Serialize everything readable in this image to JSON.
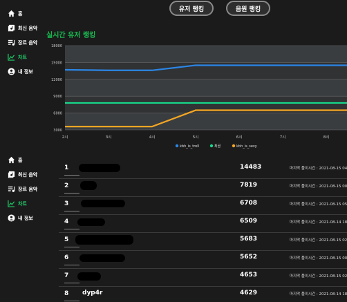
{
  "nav_top": [
    {
      "label": "홈",
      "icon": "home-icon"
    },
    {
      "label": "최신 음악",
      "icon": "new-music-icon"
    },
    {
      "label": "장르 음악",
      "icon": "genre-icon"
    },
    {
      "label": "차트",
      "icon": "chart-icon",
      "active": true
    },
    {
      "label": "내 정보",
      "icon": "account-icon"
    }
  ],
  "nav_bottom": [
    {
      "label": "홈",
      "icon": "home-icon"
    },
    {
      "label": "최신 음악",
      "icon": "new-music-icon"
    },
    {
      "label": "장르 음악",
      "icon": "genre-icon"
    },
    {
      "label": "차트",
      "icon": "chart-icon",
      "active": true
    },
    {
      "label": "내 정보",
      "icon": "account-icon"
    }
  ],
  "tabs": {
    "user_ranking": "유저 랭킹",
    "music_ranking": "음원 랭킹"
  },
  "section_title": "실시간 유저 랭킹",
  "colors": {
    "accent": "#19b84f",
    "series1": "#2b86e6",
    "series2": "#16d98b",
    "series3": "#f5a623"
  },
  "chart_data": {
    "type": "line",
    "title": "",
    "x": [
      "2시",
      "3시",
      "4시",
      "5시",
      "6시",
      "7시",
      "8시"
    ],
    "yticks": [
      3000,
      6000,
      9000,
      12000,
      15000,
      18000
    ],
    "ylim": [
      3000,
      18000
    ],
    "grid": true,
    "legend": "bottom",
    "series": [
      {
        "name": "kbh_is_troll",
        "color": "#2b86e6",
        "values": [
          13700,
          13600,
          13600,
          14500,
          14500,
          14500,
          14500,
          14500
        ]
      },
      {
        "name": "최곰",
        "color": "#16d98b",
        "values": [
          7800,
          7800,
          7800,
          7800,
          7800,
          7800,
          7800,
          7800
        ]
      },
      {
        "name": "kbh_is_sexy",
        "color": "#f5a623",
        "values": [
          3600,
          3600,
          3600,
          6500,
          6500,
          6500,
          6500,
          6500
        ]
      }
    ]
  },
  "ranking": [
    {
      "rank": "1",
      "name": "",
      "score": "14483",
      "time": "마지막 풀이시간 : 2021-08-15 04"
    },
    {
      "rank": "2",
      "name": "",
      "score": "7819",
      "time": "마지막 풀이시간 : 2021-08-15 00"
    },
    {
      "rank": "3",
      "name": "",
      "score": "6708",
      "time": "마지막 풀이시간 : 2021-08-15 05"
    },
    {
      "rank": "4",
      "name": "",
      "score": "6509",
      "time": "마지막 풀이시간 : 2021-08-14 18"
    },
    {
      "rank": "5",
      "name": "",
      "score": "5683",
      "time": "마지막 풀이시간 : 2021-08-15 02"
    },
    {
      "rank": "6",
      "name": "",
      "score": "5652",
      "time": "마지막 풀이시간 : 2021-08-15 00"
    },
    {
      "rank": "7",
      "name": "",
      "score": "4653",
      "time": "마지막 풀이시간 : 2021-08-15 02"
    },
    {
      "rank": "8",
      "name": "dyp4r",
      "score": "4629",
      "time": "마지막 풀이시간 : 2021-08-14 18"
    }
  ]
}
